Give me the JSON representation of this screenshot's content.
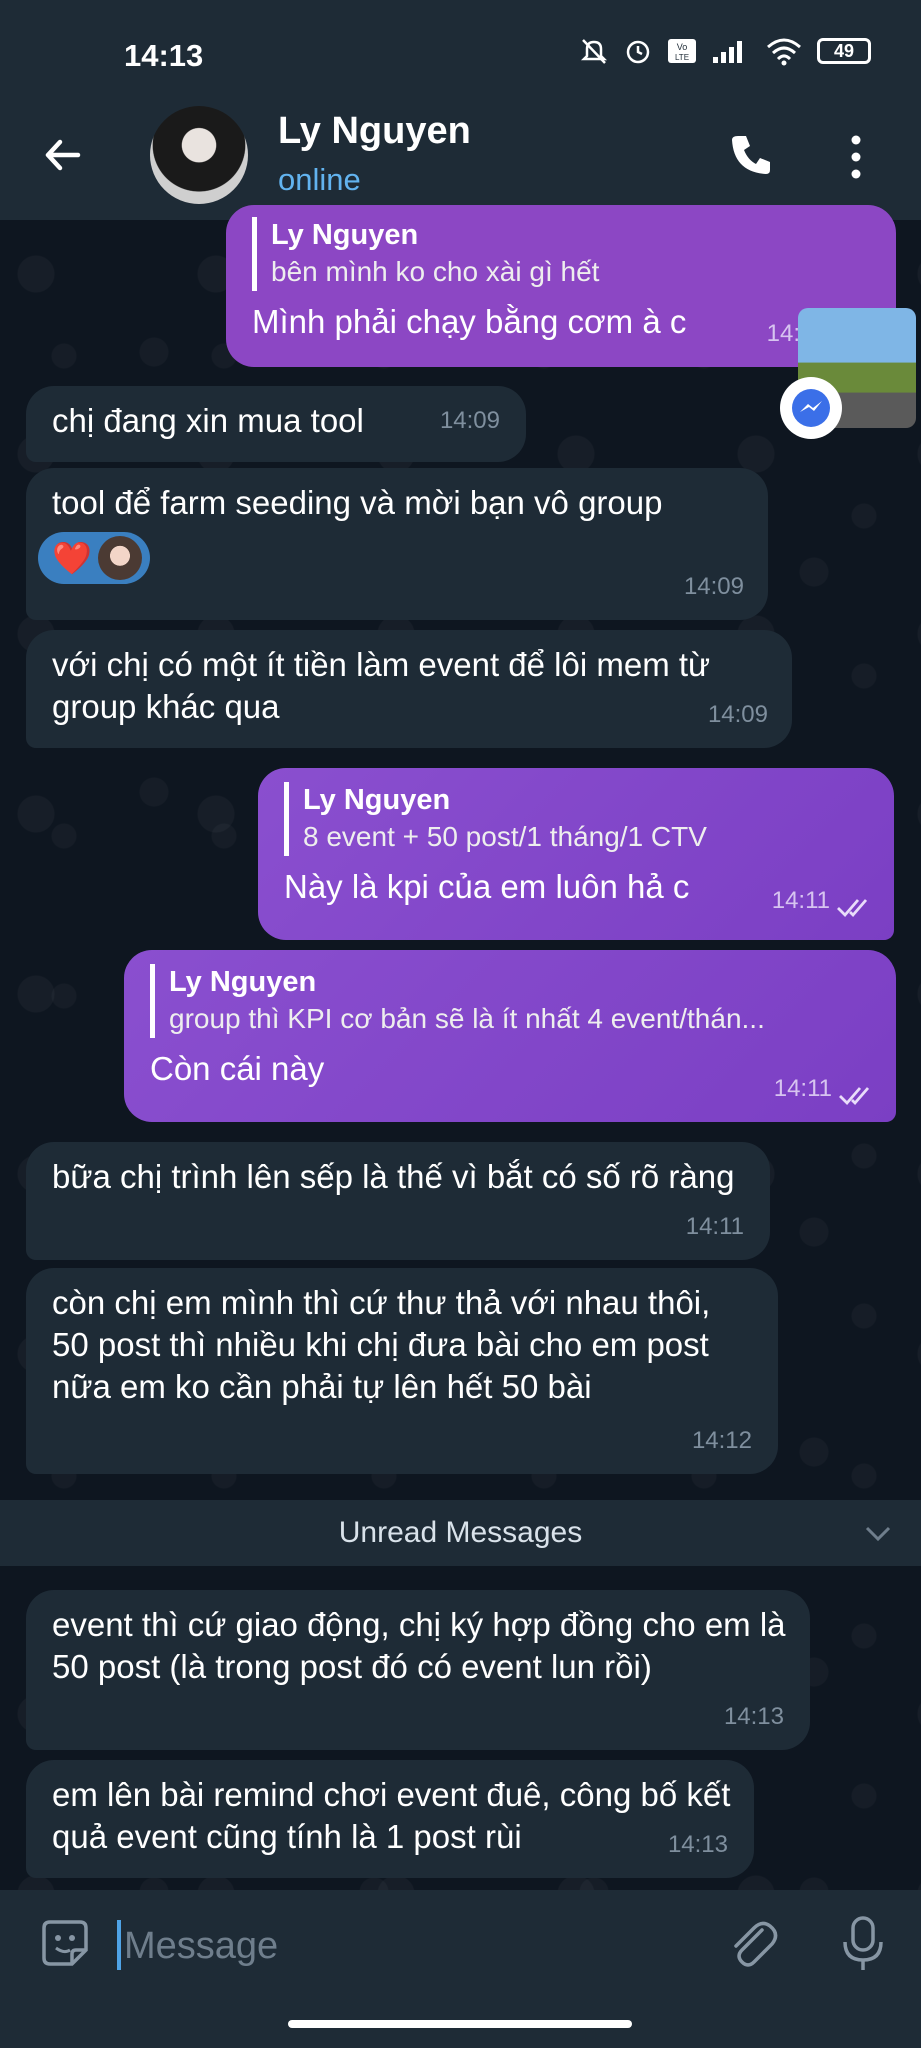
{
  "status_bar": {
    "time": "14:13",
    "battery": "49"
  },
  "header": {
    "name": "Ly Nguyen",
    "status": "online"
  },
  "messages": {
    "m0": {
      "reply_name": "Ly Nguyen",
      "reply_text": "bên mình ko cho xài gì hết",
      "text": "Mình phải chạy bằng cơm à c",
      "time": "14:"
    },
    "m1": {
      "text": "chị đang xin mua tool",
      "time": "14:09"
    },
    "m2": {
      "text": "tool để farm seeding và mời bạn vô group",
      "time": "14:09",
      "reaction": "❤️"
    },
    "m3": {
      "text": "với chị có một ít tiền làm event để lôi mem từ group khác qua",
      "time": "14:09"
    },
    "m4": {
      "reply_name": "Ly Nguyen",
      "reply_text": "8 event + 50 post/1 tháng/1 CTV",
      "text": "Này là kpi của em luôn hả c",
      "time": "14:11"
    },
    "m5": {
      "reply_name": "Ly Nguyen",
      "reply_text": "group thì KPI cơ bản sẽ là ít nhất 4 event/thán...",
      "text": "Còn cái này",
      "time": "14:11"
    },
    "m6": {
      "text": "bữa chị trình lên sếp là thế vì bắt có số rõ ràng",
      "time": "14:11"
    },
    "m7": {
      "text": "còn chị em mình thì cứ thư thả với nhau thôi, 50 post thì nhiều khi chị đưa bài cho em post nữa em ko cần phải tự lên hết 50 bài",
      "time": "14:12"
    },
    "m8": {
      "text": "event thì cứ giao động, chị ký hợp đồng cho em là 50 post (là trong post đó có event lun rồi)",
      "time": "14:13"
    },
    "m9": {
      "text": "em lên bài remind chơi event đuê, công bố kết quả event cũng tính là 1 post rùi",
      "time": "14:13"
    }
  },
  "unread_label": "Unread Messages",
  "input": {
    "placeholder": "Message"
  },
  "colors": {
    "accent": "#62b3ef",
    "outgoing": "#7b3fc4",
    "incoming": "#1e2b36",
    "background": "#0e1620"
  }
}
